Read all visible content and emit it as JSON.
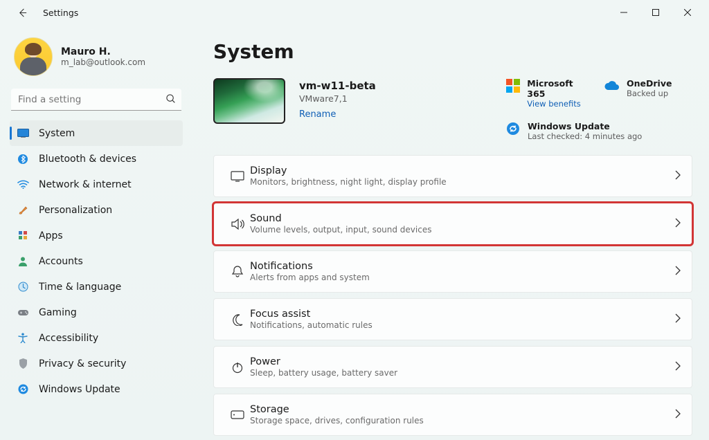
{
  "window": {
    "title": "Settings"
  },
  "user": {
    "name": "Mauro H.",
    "email": "m_lab@outlook.com"
  },
  "search": {
    "placeholder": "Find a setting"
  },
  "nav": {
    "items": [
      {
        "label": "System"
      },
      {
        "label": "Bluetooth & devices"
      },
      {
        "label": "Network & internet"
      },
      {
        "label": "Personalization"
      },
      {
        "label": "Apps"
      },
      {
        "label": "Accounts"
      },
      {
        "label": "Time & language"
      },
      {
        "label": "Gaming"
      },
      {
        "label": "Accessibility"
      },
      {
        "label": "Privacy & security"
      },
      {
        "label": "Windows Update"
      }
    ]
  },
  "page": {
    "heading": "System"
  },
  "device": {
    "name": "vm-w11-beta",
    "model": "VMware7,1",
    "rename": "Rename"
  },
  "promos": {
    "m365": {
      "title": "Microsoft 365",
      "sub": "View benefits"
    },
    "onedrive": {
      "title": "OneDrive",
      "sub": "Backed up"
    },
    "update": {
      "title": "Windows Update",
      "sub": "Last checked: 4 minutes ago"
    }
  },
  "cards": [
    {
      "title": "Display",
      "sub": "Monitors, brightness, night light, display profile"
    },
    {
      "title": "Sound",
      "sub": "Volume levels, output, input, sound devices"
    },
    {
      "title": "Notifications",
      "sub": "Alerts from apps and system"
    },
    {
      "title": "Focus assist",
      "sub": "Notifications, automatic rules"
    },
    {
      "title": "Power",
      "sub": "Sleep, battery usage, battery saver"
    },
    {
      "title": "Storage",
      "sub": "Storage space, drives, configuration rules"
    }
  ]
}
